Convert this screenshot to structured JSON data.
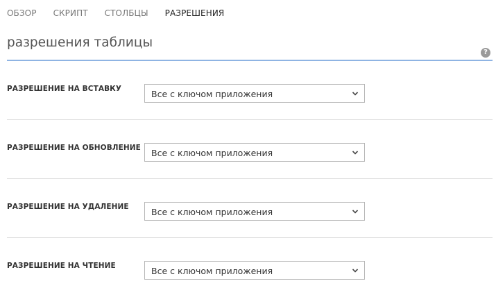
{
  "tabs": [
    {
      "label": "ОБЗОР",
      "active": false
    },
    {
      "label": "СКРИПТ",
      "active": false
    },
    {
      "label": "СТОЛБЦЫ",
      "active": false
    },
    {
      "label": "РАЗРЕШЕНИЯ",
      "active": true
    }
  ],
  "section": {
    "title": "разрешения таблицы",
    "help_icon": "question-circle"
  },
  "permissions": [
    {
      "label": "РАЗРЕШЕНИЕ НА ВСТАВКУ",
      "value": "Все с ключом приложения"
    },
    {
      "label": "РАЗРЕШЕНИЕ НА ОБНОВЛЕНИЕ",
      "value": "Все с ключом приложения"
    },
    {
      "label": "РАЗРЕШЕНИЕ НА УДАЛЕНИЕ",
      "value": "Все с ключом приложения"
    },
    {
      "label": "РАЗРЕШЕНИЕ НА ЧТЕНИЕ",
      "value": "Все с ключом приложения"
    }
  ],
  "colors": {
    "accent_underline": "#8fb4e3",
    "active_tab": "#222222",
    "inactive_tab": "#777777"
  }
}
